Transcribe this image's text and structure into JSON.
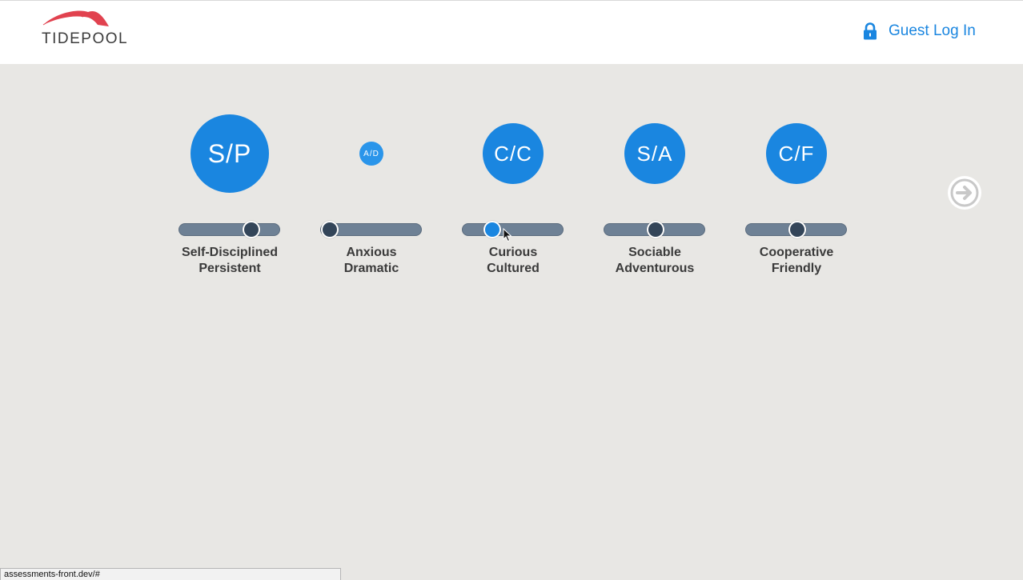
{
  "header": {
    "logo_text": "TIDEPOOL",
    "login_label": "Guest Log In",
    "accent_color": "#1a86e0"
  },
  "traits": [
    {
      "abbr": "S/P",
      "line1": "Self-Disciplined",
      "line2": "Persistent",
      "value": 0.75,
      "bubble_level": "large",
      "active": false
    },
    {
      "abbr": "A/D",
      "line1": "Anxious",
      "line2": "Dramatic",
      "value": 0.0,
      "bubble_level": "small",
      "active": false
    },
    {
      "abbr": "C/C",
      "line1": "Curious",
      "line2": "Cultured",
      "value": 0.25,
      "bubble_level": "medium",
      "active": true
    },
    {
      "abbr": "S/A",
      "line1": "Sociable",
      "line2": "Adventurous",
      "value": 0.5,
      "bubble_level": "medium",
      "active": false
    },
    {
      "abbr": "C/F",
      "line1": "Cooperative",
      "line2": "Friendly",
      "value": 0.5,
      "bubble_level": "medium",
      "active": false
    }
  ],
  "icons": {
    "lock": "lock-icon",
    "next": "arrow-right-circle-icon"
  },
  "status_bar": {
    "url": "assessments-front.dev/#"
  }
}
